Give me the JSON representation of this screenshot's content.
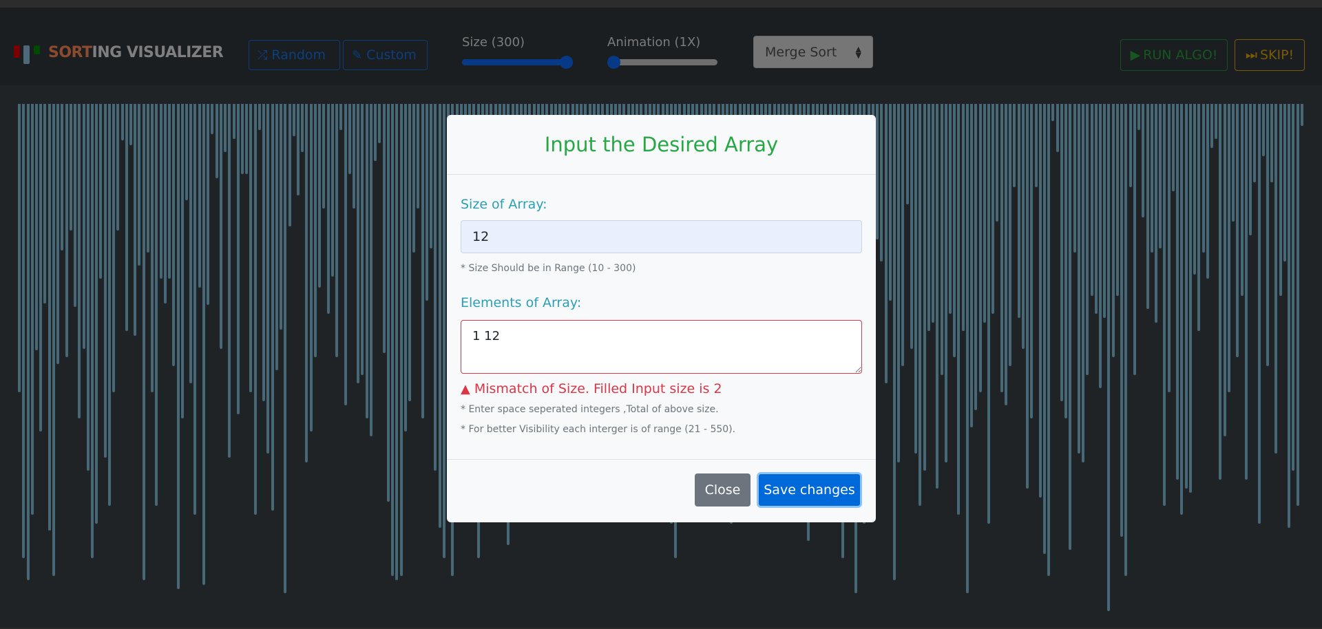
{
  "navbar": {
    "brand_accent": "SORT",
    "brand_rest": "ING VISUALIZER",
    "random_label": "Random",
    "custom_label": "Custom",
    "size_label": "Size (300)",
    "size_value": 300,
    "size_min": 10,
    "size_max": 300,
    "animation_label": "Animation (1X)",
    "animation_fraction": 0.0,
    "algorithm_selected": "Merge Sort",
    "run_label": "RUN ALGO!",
    "skip_label": "SKIP!"
  },
  "icons": {
    "random": "shuffle-icon",
    "custom": "pencil-icon",
    "run": "play-icon",
    "skip": "fast-forward-icon",
    "error": "warning-icon"
  },
  "colors": {
    "bar": "#466877",
    "title_green": "#28a745",
    "label_teal": "#2a9fb5",
    "error_red": "#dc3545",
    "primary_blue": "#0069d9"
  },
  "modal": {
    "title": "Input the Desired Array",
    "size_label": "Size of Array:",
    "size_value": "12",
    "size_hint": "* Size Should be in Range (10 - 300)",
    "elements_label": "Elements of Array:",
    "elements_value": "1 12",
    "error_text": "Mismatch of Size. Filled Input size is 2",
    "elements_hint_1": "* Enter space seperated integers ,Total of above size.",
    "elements_hint_2": "* For better Visibility each interger is of range (21 - 550).",
    "close_label": "Close",
    "save_label": "Save changes"
  },
  "array_values": [
    330,
    520,
    545,
    470,
    282,
    375,
    228,
    488,
    540,
    298,
    168,
    290,
    145,
    232,
    360,
    280,
    420,
    520,
    480,
    200,
    405,
    460,
    330,
    145,
    42,
    260,
    47,
    265,
    185,
    545,
    170,
    330,
    460,
    200,
    228,
    200,
    300,
    555,
    360,
    110,
    320,
    470,
    210,
    550,
    230,
    35,
    85,
    280,
    55,
    405,
    40,
    355,
    80,
    80,
    330,
    470,
    30,
    340,
    400,
    465,
    305,
    258,
    560,
    140,
    37,
    105,
    55,
    410,
    375,
    290,
    210,
    120,
    240,
    198,
    290,
    30,
    345,
    80,
    120,
    320,
    310,
    360,
    380,
    65,
    45,
    285,
    455,
    540,
    545,
    540,
    375,
    340,
    170,
    120,
    360,
    225,
    165,
    420,
    485,
    520,
    290,
    540,
    255,
    210,
    290,
    460,
    300,
    520,
    300,
    210,
    430,
    300,
    360,
    355,
    505,
    380,
    425,
    400,
    180,
    350,
    240,
    420,
    300,
    400,
    360,
    220,
    255,
    345,
    430,
    470,
    300,
    380,
    80,
    300,
    155,
    340,
    165,
    275,
    80,
    220,
    340,
    460,
    305,
    470,
    250,
    330,
    120,
    150,
    130,
    260,
    90,
    310,
    480,
    520,
    310,
    250,
    300,
    460,
    230,
    420,
    320,
    200,
    460,
    340,
    110,
    250,
    480,
    225,
    305,
    80,
    100,
    300,
    290,
    350,
    270,
    210,
    345,
    330,
    400,
    230,
    180,
    420,
    105,
    130,
    500,
    280,
    350,
    120,
    310,
    420,
    350,
    250,
    520,
    290,
    420,
    560,
    300,
    480,
    360,
    215,
    155,
    180,
    320,
    225,
    545,
    410,
    300,
    115,
    280,
    400,
    460,
    420,
    260,
    250,
    440,
    310,
    410,
    240,
    290,
    470,
    260,
    560,
    370,
    350,
    330,
    250,
    480,
    240,
    135,
    330,
    345,
    300,
    95,
    245,
    280,
    440,
    360,
    95,
    450,
    515,
    540,
    20,
    55,
    340,
    360,
    510,
    170,
    400,
    410,
    310,
    220,
    240,
    325,
    245,
    580,
    290,
    220,
    495,
    540,
    95,
    310,
    30,
    130,
    235,
    170,
    250,
    165,
    460,
    330,
    100,
    430,
    470,
    440,
    445,
    195,
    260,
    170,
    200,
    50,
    40,
    430,
    380,
    330,
    135,
    290,
    220,
    430,
    150,
    90,
    480,
    60,
    300,
    90,
    400,
    220,
    180,
    485,
    420,
    460,
    25
  ]
}
